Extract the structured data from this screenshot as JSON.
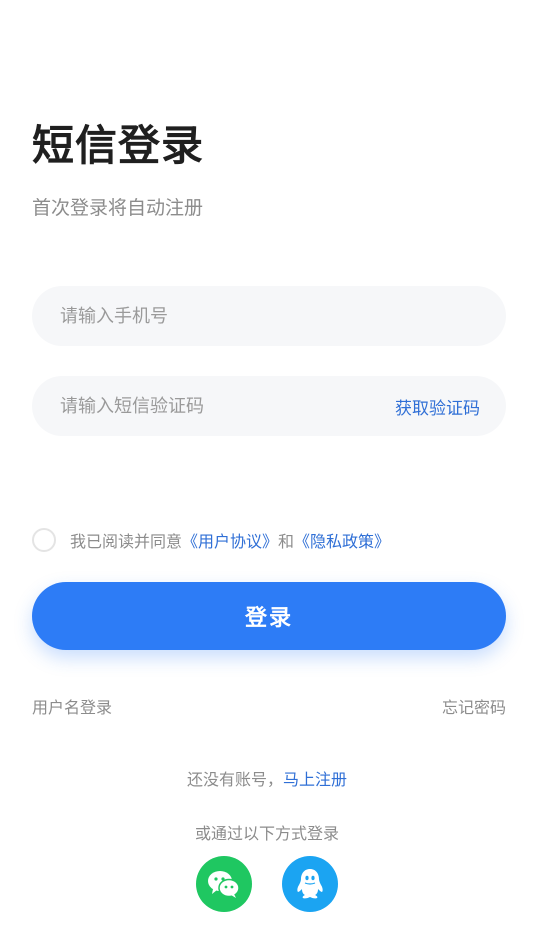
{
  "header": {
    "title": "短信登录",
    "subtitle": "首次登录将自动注册"
  },
  "form": {
    "phone_placeholder": "请输入手机号",
    "code_placeholder": "请输入短信验证码",
    "get_code_label": "获取验证码"
  },
  "agreement": {
    "prefix": "我已阅读并同意",
    "user_agreement": "《用户协议》",
    "conjunction": "和",
    "privacy_policy": "《隐私政策》",
    "checked": false
  },
  "login_button": {
    "label": "登录"
  },
  "alt_links": {
    "username_login": "用户名登录",
    "forgot_password": "忘记密码"
  },
  "register": {
    "prefix": "还没有账号，",
    "link": "马上注册"
  },
  "social": {
    "heading": "或通过以下方式登录",
    "wechat_icon": "wechat-icon",
    "qq_icon": "qq-icon"
  },
  "colors": {
    "accent": "#2d7cf6",
    "link": "#2f6fd6",
    "wechat": "#1fc761",
    "qq": "#1ba4f2"
  }
}
